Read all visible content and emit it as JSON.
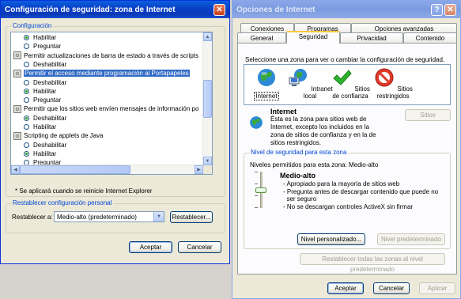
{
  "left_dialog": {
    "title": "Configuración de seguridad: zona de Internet",
    "settings_group_label": "Configuración",
    "tree_items": [
      {
        "type": "radio",
        "label": "Habilitar",
        "checked": true
      },
      {
        "type": "radio",
        "label": "Preguntar",
        "checked": false
      },
      {
        "type": "setting",
        "label": "Permitir actualizaciones de barra de estado a través de scripts"
      },
      {
        "type": "radio",
        "label": "Deshabilitar",
        "checked": false
      },
      {
        "type": "setting",
        "label": "Permitir el acceso mediante programación al Portapapeles",
        "selected": true
      },
      {
        "type": "radio",
        "label": "Deshabilitar",
        "checked": false
      },
      {
        "type": "radio",
        "label": "Habilitar",
        "checked": true
      },
      {
        "type": "radio",
        "label": "Preguntar",
        "checked": false
      },
      {
        "type": "setting",
        "label": "Permitir que los sitios web envíen mensajes de información po"
      },
      {
        "type": "radio",
        "label": "Deshabilitar",
        "checked": true
      },
      {
        "type": "radio",
        "label": "Habilitar",
        "checked": false
      },
      {
        "type": "setting",
        "label": "Scripting de applets de Java"
      },
      {
        "type": "radio",
        "label": "Deshabilitar",
        "checked": false
      },
      {
        "type": "radio",
        "label": "Habilitar",
        "checked": true
      },
      {
        "type": "radio",
        "label": "Preguntar",
        "checked": false
      }
    ],
    "restart_note": "* Se aplicará cuando se reinicie Internet Explorer",
    "reset_group_label": "Restablecer configuración personal",
    "reset_to_label": "Restablecer a:",
    "reset_select_value": "Medio-alto (predeterminado)",
    "reset_button": "Restablecer...",
    "ok_button": "Aceptar",
    "cancel_button": "Cancelar"
  },
  "right_dialog": {
    "title": "Opciones de Internet",
    "tabs_row1": [
      "Conexiones",
      "Programas",
      "Opciones avanzadas"
    ],
    "tabs_row2": [
      "General",
      "Seguridad",
      "Privacidad",
      "Contenido"
    ],
    "active_tab": "Seguridad",
    "zone_prompt": "Seleccione una zona para ver o cambiar la configuración de seguridad.",
    "zones": [
      {
        "label": "Internet",
        "icon": "globe-icon",
        "selected": true
      },
      {
        "label": "Intranet local",
        "icon": "intranet-icon",
        "selected": false
      },
      {
        "label": "Sitios de confianza",
        "icon": "checkmark-icon",
        "selected": false
      },
      {
        "label": "Sitios restringidos",
        "icon": "no-entry-icon",
        "selected": false
      }
    ],
    "zone_title": "Internet",
    "zone_description": "Ésta es la zona para sitios web de Internet, excepto los incluidos en la zona de sitios de confianza y en la de sitios restringidos.",
    "sites_button": "Sitios",
    "security_level_group": "Nivel de seguridad para esta zona",
    "allowed_levels_text": "Niveles permitidos para esta zona: Medio-alto",
    "level_name": "Medio-alto",
    "level_bullets": [
      "- Apropiado para la mayoría de sitios web",
      "- Pregunta antes de descargar contenido que puede no",
      "  ser seguro",
      "- No se descargan controles ActiveX sin firmar"
    ],
    "slider_level_fraction": 0.5,
    "custom_level_button": "Nivel personalizado...",
    "default_level_button": "Nivel predeterminado",
    "reset_all_zones_button": "Restablecer todas las zonas al nivel predeterminado",
    "ok_button": "Aceptar",
    "cancel_button": "Cancelar",
    "apply_button": "Aplicar"
  }
}
